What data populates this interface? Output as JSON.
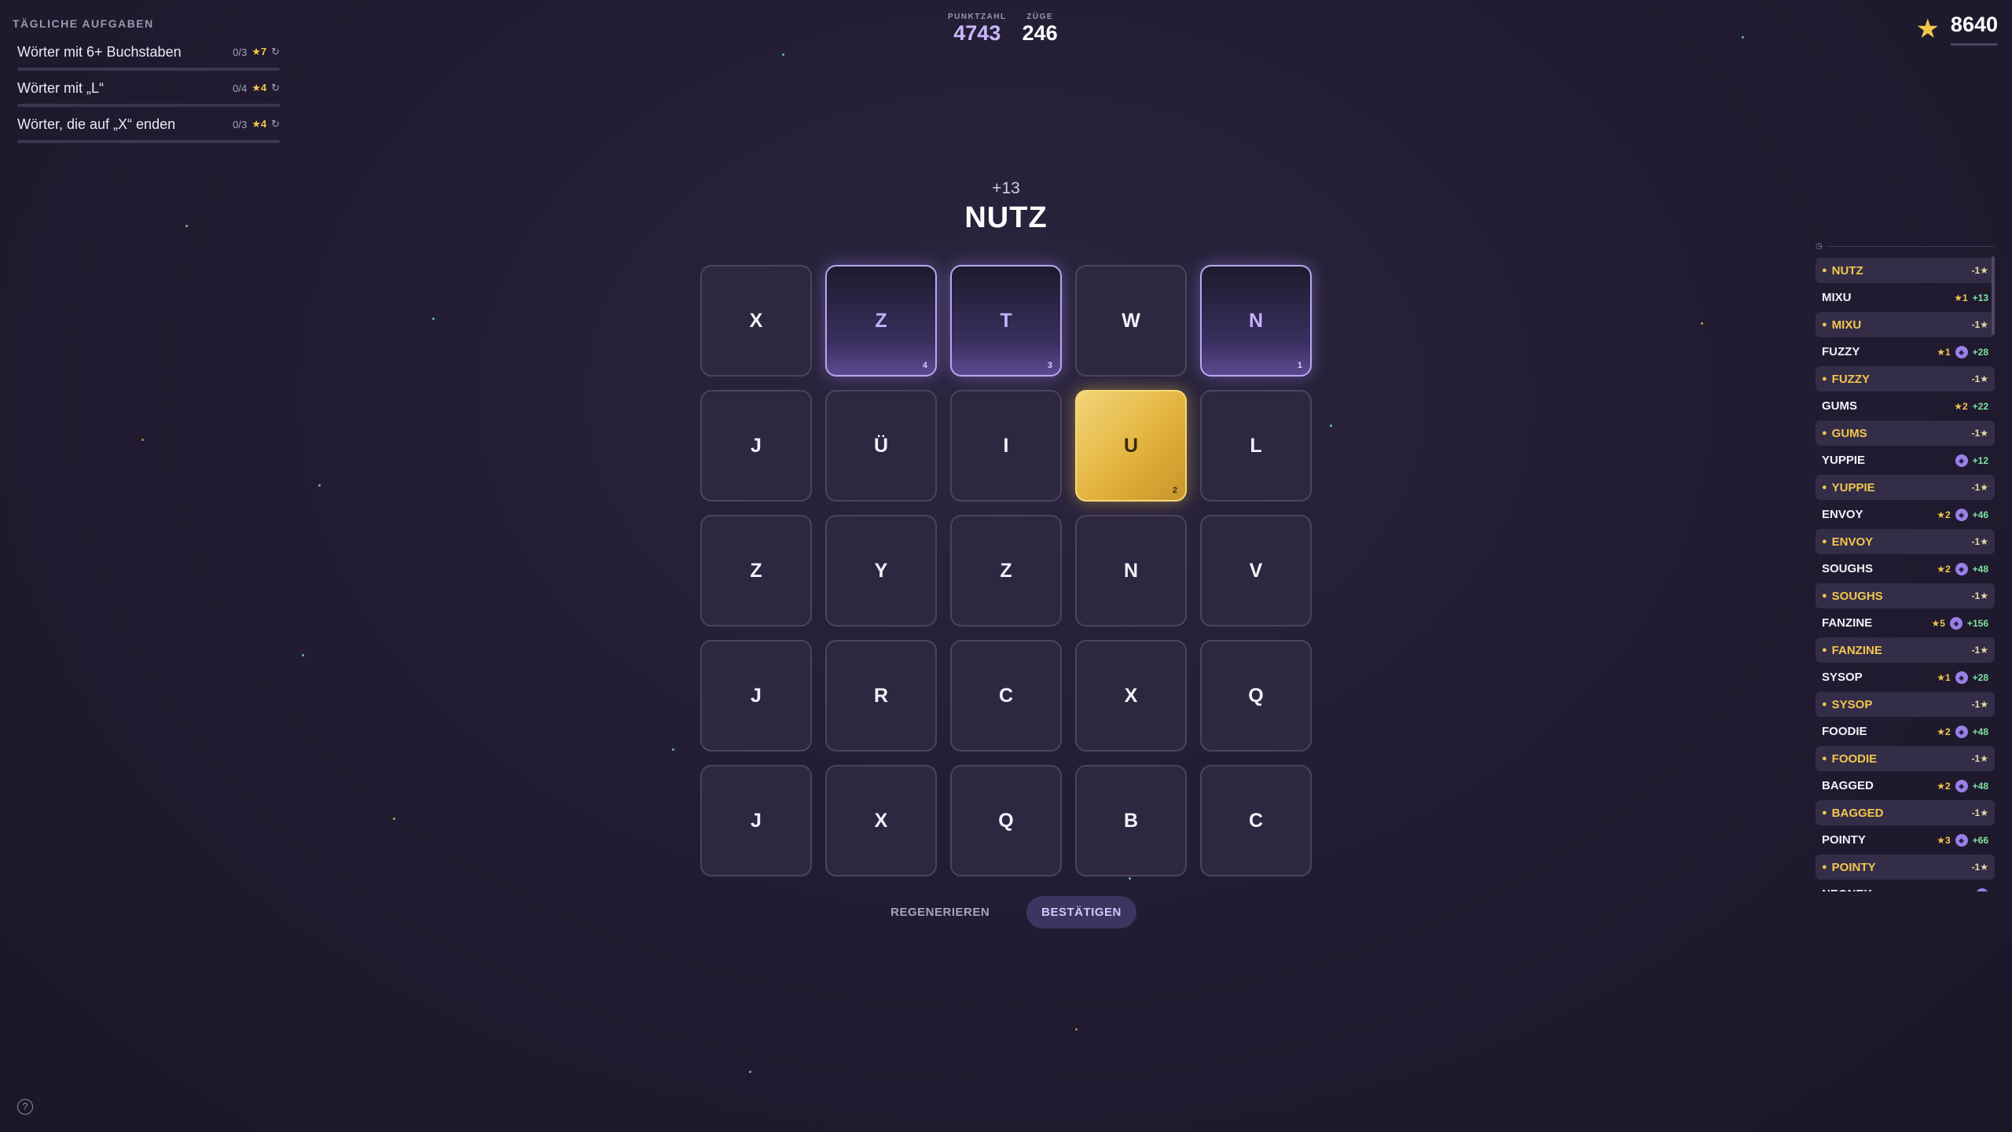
{
  "daily_tasks": {
    "title": "TÄGLICHE AUFGABEN",
    "items": [
      {
        "label": "Wörter mit 6+ Buchstaben",
        "progress": "0/3",
        "reward": "★7",
        "refresh_icon": "refresh-icon"
      },
      {
        "label": "Wörter mit „L“",
        "progress": "0/4",
        "reward": "★4",
        "refresh_icon": "refresh-icon"
      },
      {
        "label": "Wörter, die auf „X“ enden",
        "progress": "0/3",
        "reward": "★4",
        "refresh_icon": "refresh-icon"
      }
    ]
  },
  "stats": {
    "score_label": "PUNKTZAHL",
    "score": "4743",
    "moves_label": "ZÜGE",
    "moves": "246"
  },
  "stars": {
    "icon": "star-icon",
    "value": "8640"
  },
  "current_word": {
    "score": "+13",
    "word": "NUTZ"
  },
  "grid": [
    {
      "letter": "X",
      "state": "normal",
      "order": ""
    },
    {
      "letter": "Z",
      "state": "selected",
      "order": "4"
    },
    {
      "letter": "T",
      "state": "selected",
      "order": "3"
    },
    {
      "letter": "W",
      "state": "normal",
      "order": ""
    },
    {
      "letter": "N",
      "state": "selected",
      "order": "1"
    },
    {
      "letter": "J",
      "state": "normal",
      "order": ""
    },
    {
      "letter": "Ü",
      "state": "normal",
      "order": ""
    },
    {
      "letter": "I",
      "state": "normal",
      "order": ""
    },
    {
      "letter": "U",
      "state": "gold",
      "order": "2"
    },
    {
      "letter": "L",
      "state": "normal",
      "order": ""
    },
    {
      "letter": "Z",
      "state": "normal",
      "order": ""
    },
    {
      "letter": "Y",
      "state": "normal",
      "order": ""
    },
    {
      "letter": "Z",
      "state": "normal",
      "order": ""
    },
    {
      "letter": "N",
      "state": "normal",
      "order": ""
    },
    {
      "letter": "V",
      "state": "normal",
      "order": ""
    },
    {
      "letter": "J",
      "state": "normal",
      "order": ""
    },
    {
      "letter": "R",
      "state": "normal",
      "order": ""
    },
    {
      "letter": "C",
      "state": "normal",
      "order": ""
    },
    {
      "letter": "X",
      "state": "normal",
      "order": ""
    },
    {
      "letter": "Q",
      "state": "normal",
      "order": ""
    },
    {
      "letter": "J",
      "state": "normal",
      "order": ""
    },
    {
      "letter": "X",
      "state": "normal",
      "order": ""
    },
    {
      "letter": "Q",
      "state": "normal",
      "order": ""
    },
    {
      "letter": "B",
      "state": "normal",
      "order": ""
    },
    {
      "letter": "C",
      "state": "normal",
      "order": ""
    }
  ],
  "actions": {
    "regenerate": "REGENERIEREN",
    "confirm": "BESTÄTIGEN"
  },
  "word_list": [
    {
      "type": "cost",
      "word": "NUTZ",
      "cost": "-1★"
    },
    {
      "type": "word",
      "word": "MIXU",
      "stars": "★1",
      "badge": false,
      "points": "+13"
    },
    {
      "type": "cost",
      "word": "MIXU",
      "cost": "-1★"
    },
    {
      "type": "word",
      "word": "FUZZY",
      "stars": "★1",
      "badge": true,
      "points": "+28"
    },
    {
      "type": "cost",
      "word": "FUZZY",
      "cost": "-1★"
    },
    {
      "type": "word",
      "word": "GUMS",
      "stars": "★2",
      "badge": false,
      "points": "+22"
    },
    {
      "type": "cost",
      "word": "GUMS",
      "cost": "-1★"
    },
    {
      "type": "word",
      "word": "YUPPIE",
      "stars": "",
      "badge": true,
      "points": "+12"
    },
    {
      "type": "cost",
      "word": "YUPPIE",
      "cost": "-1★"
    },
    {
      "type": "word",
      "word": "ENVOY",
      "stars": "★2",
      "badge": true,
      "points": "+46"
    },
    {
      "type": "cost",
      "word": "ENVOY",
      "cost": "-1★"
    },
    {
      "type": "word",
      "word": "SOUGHS",
      "stars": "★2",
      "badge": true,
      "points": "+48"
    },
    {
      "type": "cost",
      "word": "SOUGHS",
      "cost": "-1★"
    },
    {
      "type": "word",
      "word": "FANZINE",
      "stars": "★5",
      "badge": true,
      "points": "+156"
    },
    {
      "type": "cost",
      "word": "FANZINE",
      "cost": "-1★"
    },
    {
      "type": "word",
      "word": "SYSOP",
      "stars": "★1",
      "badge": true,
      "points": "+28"
    },
    {
      "type": "cost",
      "word": "SYSOP",
      "cost": "-1★"
    },
    {
      "type": "word",
      "word": "FOODIE",
      "stars": "★2",
      "badge": true,
      "points": "+48"
    },
    {
      "type": "cost",
      "word": "FOODIE",
      "cost": "-1★"
    },
    {
      "type": "word",
      "word": "BAGGED",
      "stars": "★2",
      "badge": true,
      "points": "+48"
    },
    {
      "type": "cost",
      "word": "BAGGED",
      "cost": "-1★"
    },
    {
      "type": "word",
      "word": "POINTY",
      "stars": "★3",
      "badge": true,
      "points": "+66"
    },
    {
      "type": "cost",
      "word": "POINTY",
      "cost": "-1★"
    },
    {
      "type": "word",
      "word": "NEONEK",
      "stars": "",
      "badge": true,
      "points": ""
    }
  ],
  "help": {
    "icon": "help-icon",
    "label": "?"
  },
  "colors": {
    "accent": "#c3b2ff",
    "gold": "#f3c64c",
    "background": "#221d33",
    "positive": "#7fe3a0"
  }
}
